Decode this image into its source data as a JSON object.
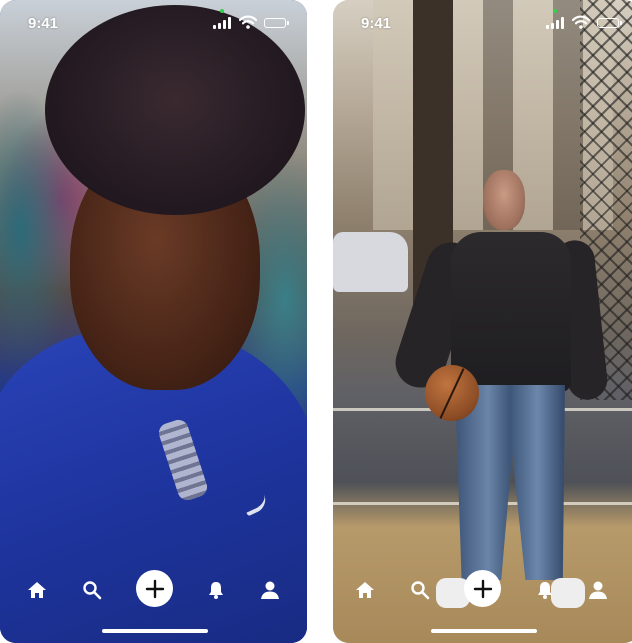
{
  "screens": [
    {
      "status_bar": {
        "time": "9:41",
        "battery_level": 1.0
      },
      "photo": "woman-in-blue-jacket",
      "tab_bar": {
        "items": [
          "home-icon",
          "search-icon",
          "add-icon",
          "bell-icon",
          "profile-icon"
        ]
      }
    },
    {
      "status_bar": {
        "time": "9:41",
        "battery_level": 1.0
      },
      "photo": "man-holding-basketball-on-court",
      "tab_bar": {
        "items": [
          "home-icon",
          "search-icon",
          "add-icon",
          "bell-icon",
          "profile-icon"
        ]
      }
    }
  ],
  "colors": {
    "icon": "#ffffff",
    "add_button_bg": "#ffffff",
    "add_button_icon": "#111111",
    "camera_indicator": "#35d04a"
  }
}
